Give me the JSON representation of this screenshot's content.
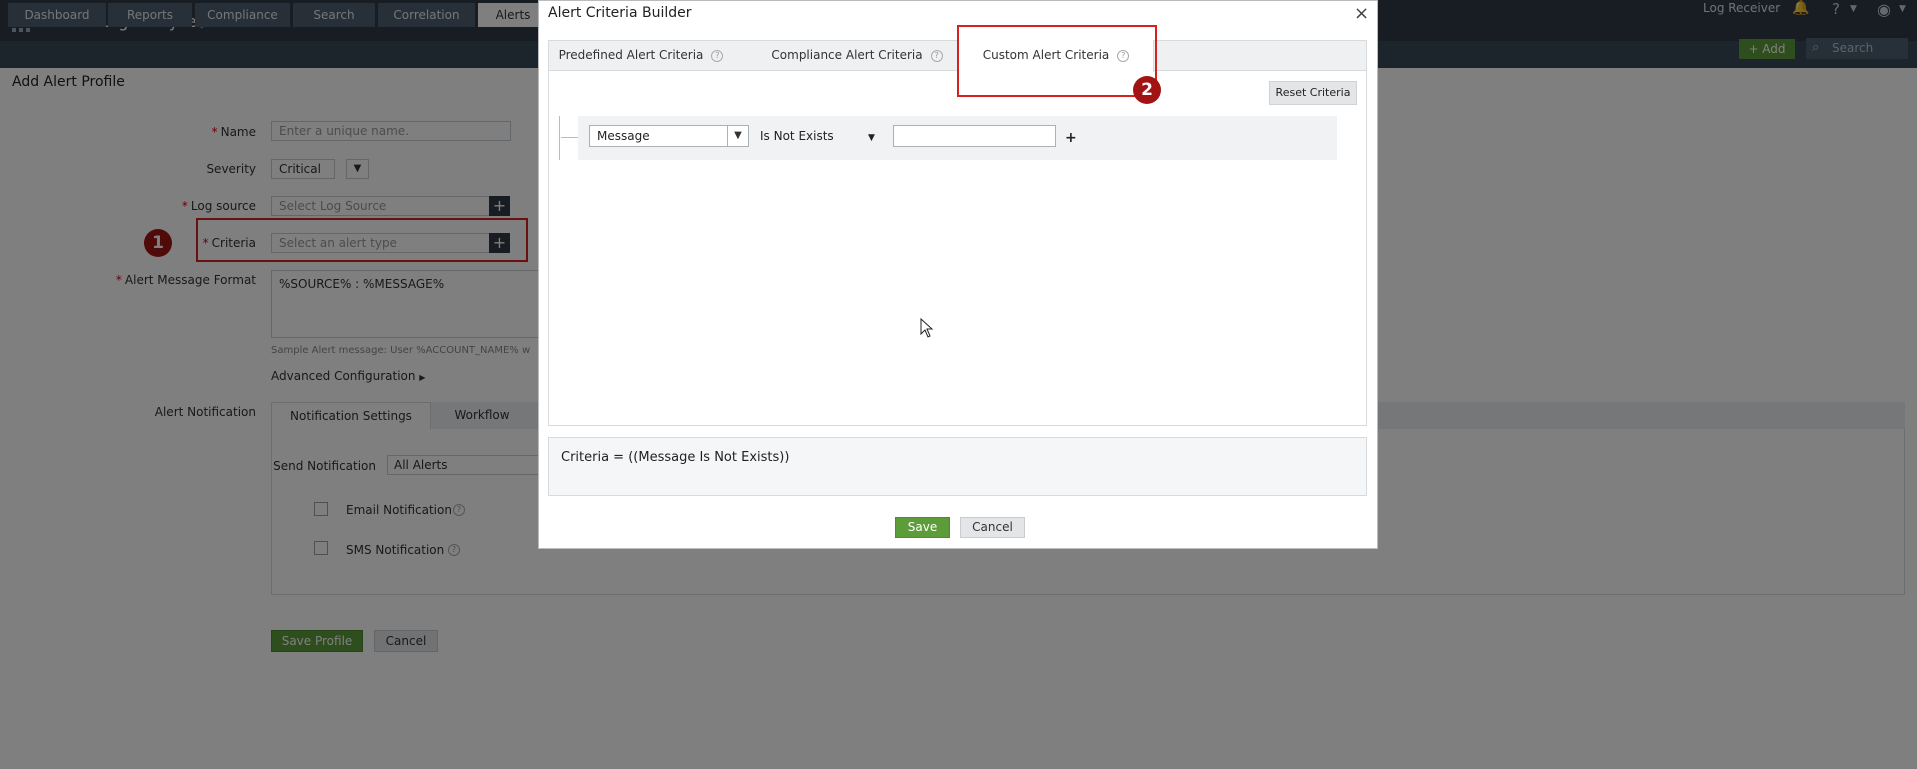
{
  "topbar": {
    "app_name": "EventLog Analyzer",
    "log_receiver": "Log Receiver",
    "help": "?",
    "add_label": "+ Add",
    "search_placeholder": "Search"
  },
  "nav": {
    "tabs": [
      {
        "label": "Dashboard"
      },
      {
        "label": "Reports"
      },
      {
        "label": "Compliance"
      },
      {
        "label": "Search"
      },
      {
        "label": "Correlation"
      },
      {
        "label": "Alerts"
      }
    ]
  },
  "page": {
    "title": "Add Alert Profile",
    "name_label": "Name",
    "name_placeholder": "Enter a unique name.",
    "severity_label": "Severity",
    "severity_value": "Critical",
    "log_source_label": "Log source",
    "log_source_placeholder": "Select Log Source",
    "criteria_label": "Criteria",
    "criteria_placeholder": "Select an alert type",
    "msg_format_label": "Alert Message Format",
    "msg_format_value": "%SOURCE% : %MESSAGE%",
    "sample_text": "Sample Alert message: User %ACCOUNT_NAME% w",
    "advanced_label": "Advanced Configuration",
    "alert_notification_label": "Alert Notification",
    "notif_tabs": [
      {
        "label": "Notification Settings"
      },
      {
        "label": "Workflow"
      }
    ],
    "send_notification_label": "Send Notification",
    "send_notification_value": "All Alerts",
    "email_label": "Email Notification",
    "sms_label": "SMS Notification",
    "save_profile_label": "Save Profile",
    "cancel_label": "Cancel"
  },
  "callouts": {
    "badge_1": "1",
    "badge_2": "2"
  },
  "modal": {
    "title": "Alert Criteria Builder",
    "close": "×",
    "tabs": [
      {
        "label": "Predefined Alert Criteria"
      },
      {
        "label": "Compliance Alert Criteria"
      },
      {
        "label": "Custom Alert Criteria"
      }
    ],
    "help_glyph": "?",
    "reset_label": "Reset Criteria",
    "condition": {
      "field": "Message",
      "operator": "Is Not Exists",
      "value": "",
      "add": "+"
    },
    "criteria_summary": "Criteria = ((Message Is Not Exists))",
    "save_label": "Save",
    "cancel_label": "Cancel"
  },
  "colors": {
    "accent_green": "#5c9d3a",
    "callout_red": "#d42121",
    "badge_red": "#a21414",
    "topbar": "#2f3b44"
  }
}
